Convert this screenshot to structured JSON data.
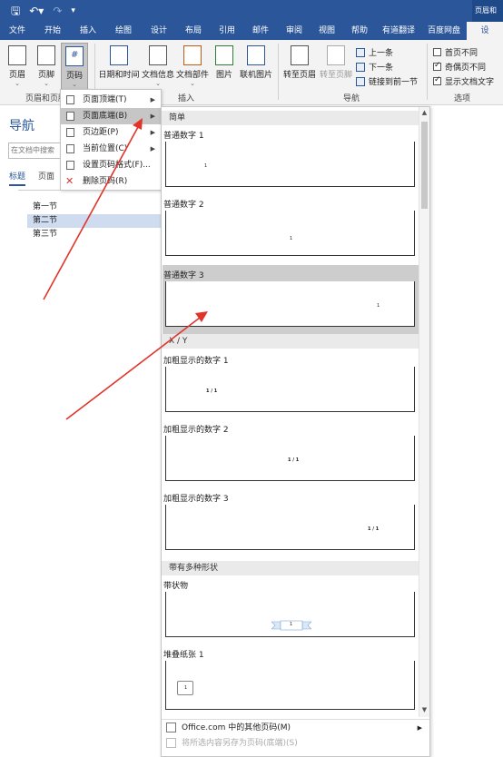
{
  "qat": {
    "save_icon": "save-icon",
    "undo_icon": "undo-icon",
    "redo_icon": "redo-icon",
    "customize_icon": "customize-icon"
  },
  "window_title": "页眉和",
  "tabs": [
    "文件",
    "开始",
    "插入",
    "绘图",
    "设计",
    "布局",
    "引用",
    "邮件",
    "审阅",
    "视图",
    "帮助",
    "有道翻译",
    "百度网盘",
    "设"
  ],
  "ribbon": {
    "header_label": "页眉",
    "footer_label": "页脚",
    "pagenum_label": "页码",
    "datetime_label": "日期和时间",
    "docinfo_label": "文档信息",
    "docparts_label": "文档部件",
    "picture_label": "图片",
    "online_picture_label": "联机图片",
    "goto_header_label": "转至页眉",
    "goto_footer_label": "转至页脚",
    "prev_label": "上一条",
    "next_label": "下一条",
    "link_prev_label": "链接到前一节",
    "first_page_diff_label": "首页不同",
    "odd_even_diff_label": "奇偶页不同",
    "show_doc_text_label": "显示文档文字",
    "group_header_footer": "页眉和页脚",
    "group_insert": "插入",
    "group_nav": "导航",
    "group_options": "选项",
    "options_checked": [
      false,
      true,
      true
    ]
  },
  "nav": {
    "title": "导航",
    "search_placeholder": "在文档中搜索",
    "tab_headings": "标题",
    "tab_pages": "页面",
    "items": [
      "第一节",
      "第二节",
      "第三节"
    ]
  },
  "menu": {
    "items": [
      {
        "label": "页面顶端(T)",
        "has_submenu": true
      },
      {
        "label": "页面底端(B)",
        "has_submenu": true
      },
      {
        "label": "页边距(P)",
        "has_submenu": true
      },
      {
        "label": "当前位置(C)",
        "has_submenu": true
      },
      {
        "label": "设置页码格式(F)...",
        "has_submenu": false
      },
      {
        "label": "删除页码(R)",
        "has_submenu": false
      }
    ]
  },
  "gallery": {
    "section_simple": "简单",
    "section_xy": "X / Y",
    "section_shapes": "带有多种形状",
    "items": [
      {
        "name": "普通数字 1",
        "sample": "1"
      },
      {
        "name": "普通数字 2",
        "sample": "1"
      },
      {
        "name": "普通数字 3",
        "sample": "1"
      },
      {
        "name": "加粗显示的数字 1",
        "sample": "1 / 1"
      },
      {
        "name": "加粗显示的数字 2",
        "sample": "1 / 1"
      },
      {
        "name": "加粗显示的数字 3",
        "sample": "1 / 1"
      },
      {
        "name": "带状物",
        "sample": "1"
      },
      {
        "name": "堆叠纸张 1",
        "sample": "1"
      }
    ],
    "footer_more": "Office.com 中的其他页码(M)",
    "footer_save": "将所选内容另存为页码(底端)(S)"
  }
}
